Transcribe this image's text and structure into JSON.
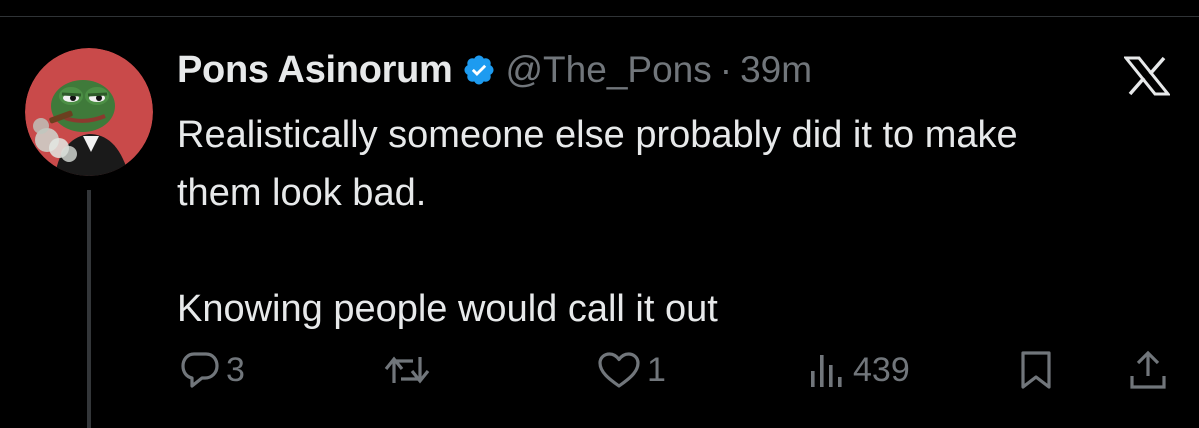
{
  "tweet": {
    "display_name": "Pons Asinorum",
    "handle": "@The_Pons",
    "separator": "·",
    "time": "39m",
    "verified": true,
    "text": "Realistically someone else probably did it to make\nthem look bad.\n\nKnowing people would call it out"
  },
  "actions": {
    "reply_count": "3",
    "repost_count": "",
    "like_count": "1",
    "views_count": "439"
  },
  "colors": {
    "background": "#000000",
    "text_primary": "#e7e9ea",
    "text_secondary": "#71767b",
    "verified_badge": "#1d9bf0",
    "avatar_background": "#c94a4a",
    "divider": "#2f3336"
  },
  "icons": {
    "verified": "verified-badge-icon",
    "brand": "x-logo-icon",
    "reply": "reply-icon",
    "repost": "repost-icon",
    "like": "heart-icon",
    "views": "views-icon",
    "bookmark": "bookmark-icon",
    "share": "share-icon"
  }
}
